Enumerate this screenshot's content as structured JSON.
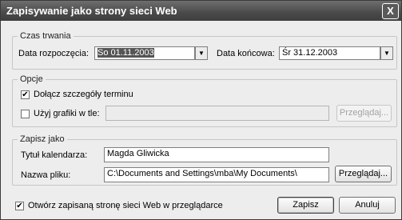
{
  "window": {
    "title": "Zapisywanie jako strony sieci Web",
    "close_symbol": "X"
  },
  "duration": {
    "legend": "Czas trwania",
    "start_label": "Data rozpoczęcia:",
    "start_value": "So 01.11.2003",
    "end_label": "Data końcowa:",
    "end_value": "Śr 31.12.2003"
  },
  "options": {
    "legend": "Opcje",
    "include_details_label": "Dołącz szczegóły terminu",
    "include_details_checked": "✔",
    "background_label": "Użyj grafiki w tle:",
    "background_value": "",
    "browse_label": "Przeglądaj..."
  },
  "save_as": {
    "legend": "Zapisz jako",
    "title_label": "Tytuł kalendarza:",
    "title_value": "Magda Gliwicka",
    "filename_label": "Nazwa pliku:",
    "filename_value": "C:\\Documents and Settings\\mba\\My Documents\\",
    "browse_label": "Przeglądaj..."
  },
  "footer": {
    "open_in_browser_label": "Otwórz zapisaną stronę sieci Web w przeglądarce",
    "open_in_browser_checked": "✔",
    "save_button": "Zapisz",
    "cancel_button": "Anuluj"
  }
}
